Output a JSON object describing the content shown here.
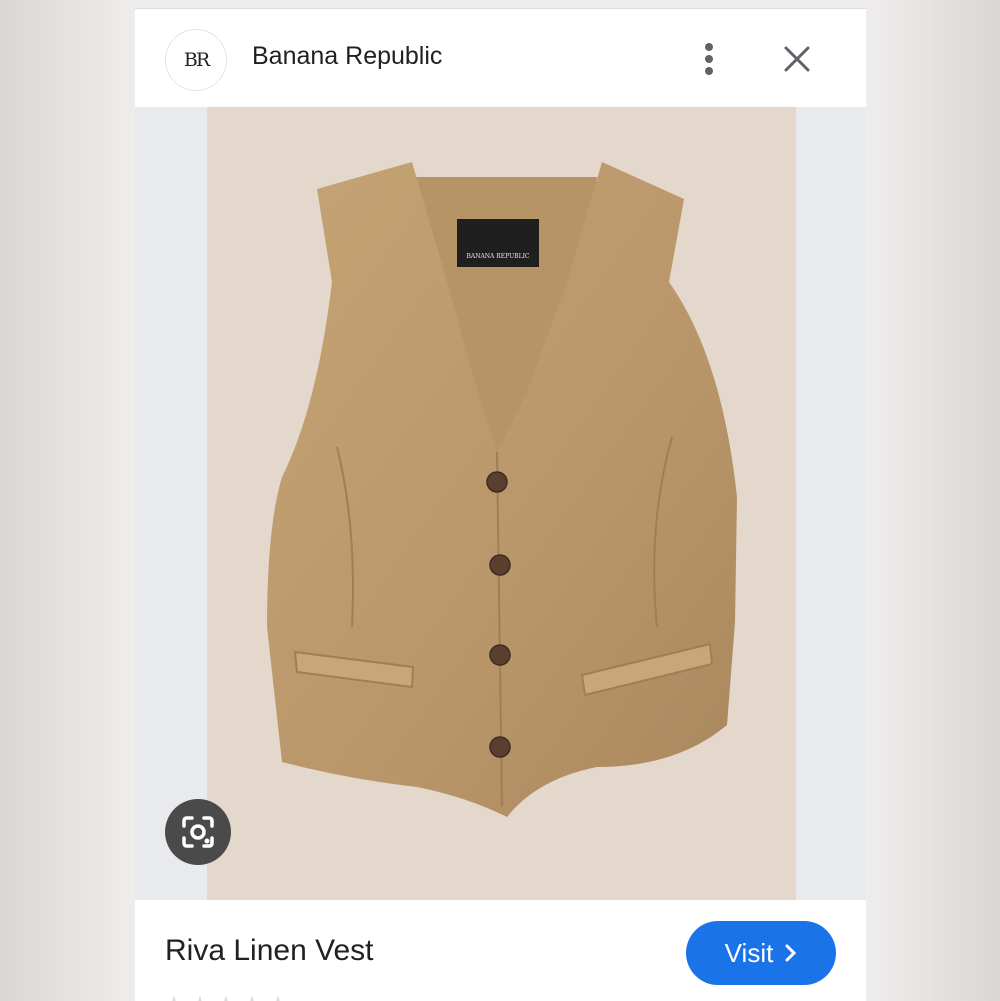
{
  "header": {
    "logo_text": "BR",
    "site_name": "Banana Republic"
  },
  "product": {
    "label_text": "BANANA REPUBLIC",
    "title": "Riva Linen Vest",
    "visit_label": "Visit",
    "rating_stars": 5
  },
  "icons": {
    "more": "more-vert-icon",
    "close": "close-icon",
    "lens": "lens-icon",
    "visit_arrow": "chevron-right-icon"
  },
  "colors": {
    "accent": "#1a73e8",
    "photo_background": "#e4d7cb",
    "vest": "#bc9a6b"
  }
}
